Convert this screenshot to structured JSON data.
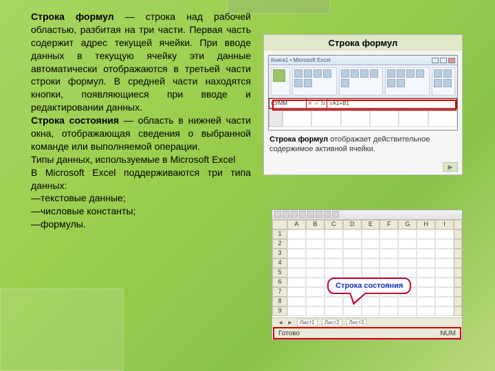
{
  "text": {
    "p1_bold": "Строка формул",
    "p1_rest": " — строка над рабочей областью, разбитая на три части. Первая часть содержит адрес текущей ячейки. При вводе данных в текущую ячейку эти данные автоматически отображаются в третьей части строки формул. В средней части находятся кнопки, появляющиеся при вводе и редактировании данных.",
    "p2_bold": "Строка состояния",
    "p2_rest": " — область в нижней части окна, отображающая сведения о выбранной команде или выполняемой операции.",
    "p3": "Типы данных, используемые в Microsoft Excel",
    "p4": "В Microsoft Excel поддерживаются три типа данных:",
    "li1": "—текстовые данные;",
    "li2": "—числовые константы;",
    "li3": "—формулы."
  },
  "fig1": {
    "title": "Строка формул",
    "win_title": "Книга1 • Microsoft Excel",
    "namebox": "СУММ",
    "fx_btn1": "✕",
    "fx_btn2": "✓",
    "fx_btn3": "fx",
    "formula": "=A1+B1",
    "caption_bold": "Строка формул",
    "caption_rest": " отображает действительное содержимое активной ячейки."
  },
  "fig2": {
    "cols": [
      "",
      "A",
      "B",
      "C",
      "D",
      "E",
      "F",
      "G",
      "H",
      "I",
      ""
    ],
    "rows": [
      "1",
      "2",
      "3",
      "4",
      "5",
      "6",
      "7",
      "8",
      "9"
    ],
    "callout": "Строка состояния",
    "status_left": "Готово",
    "status_right": "NUM",
    "sheets": [
      "Лист1",
      "Лист2",
      "Лист3"
    ]
  }
}
